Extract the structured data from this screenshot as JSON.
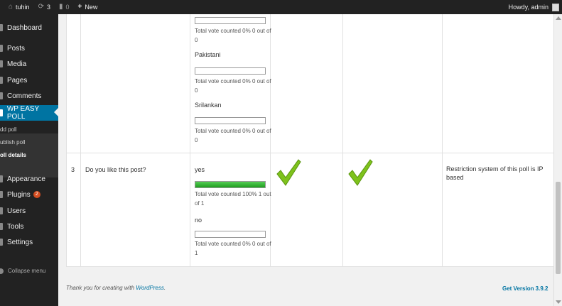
{
  "adminbar": {
    "site_name": "tuhin",
    "updates_count": "3",
    "comments_count": "0",
    "new_label": "New",
    "greeting": "Howdy, admin"
  },
  "sidebar": {
    "items": [
      {
        "label": "Dashboard"
      },
      {
        "label": "Posts"
      },
      {
        "label": "Media"
      },
      {
        "label": "Pages"
      },
      {
        "label": "Comments"
      },
      {
        "label": "WP EASY POLL"
      },
      {
        "label": "Appearance"
      },
      {
        "label": "Plugins",
        "badge": "2"
      },
      {
        "label": "Users"
      },
      {
        "label": "Tools"
      },
      {
        "label": "Settings"
      }
    ],
    "submenu": [
      "dd poll",
      "ublish poll",
      "oll details"
    ],
    "collapse_label": "Collapse menu"
  },
  "table": {
    "row_prev": {
      "options": [
        {
          "label": "",
          "stat": "Total vote counted 0% 0 out of 0",
          "percent": 0
        },
        {
          "label": "Pakistani",
          "stat": "Total vote counted 0% 0 out of 0",
          "percent": 0
        },
        {
          "label": "Srilankan",
          "stat": "Total vote counted 0% 0 out of 0",
          "percent": 0
        }
      ]
    },
    "row_3": {
      "number": "3",
      "question": "Do you like this post?",
      "options": [
        {
          "label": "yes",
          "stat": "Total vote counted 100% 1 out of 1",
          "percent": 100
        },
        {
          "label": "no",
          "stat": "Total vote counted 0% 0 out of 1",
          "percent": 0
        }
      ],
      "restriction": "Restriction system of this poll is IP based"
    }
  },
  "footer": {
    "thanks_prefix": "Thank you for creating with",
    "wordpress": "WordPress",
    "thanks_suffix": ".",
    "version": "Get Version 3.9.2"
  }
}
